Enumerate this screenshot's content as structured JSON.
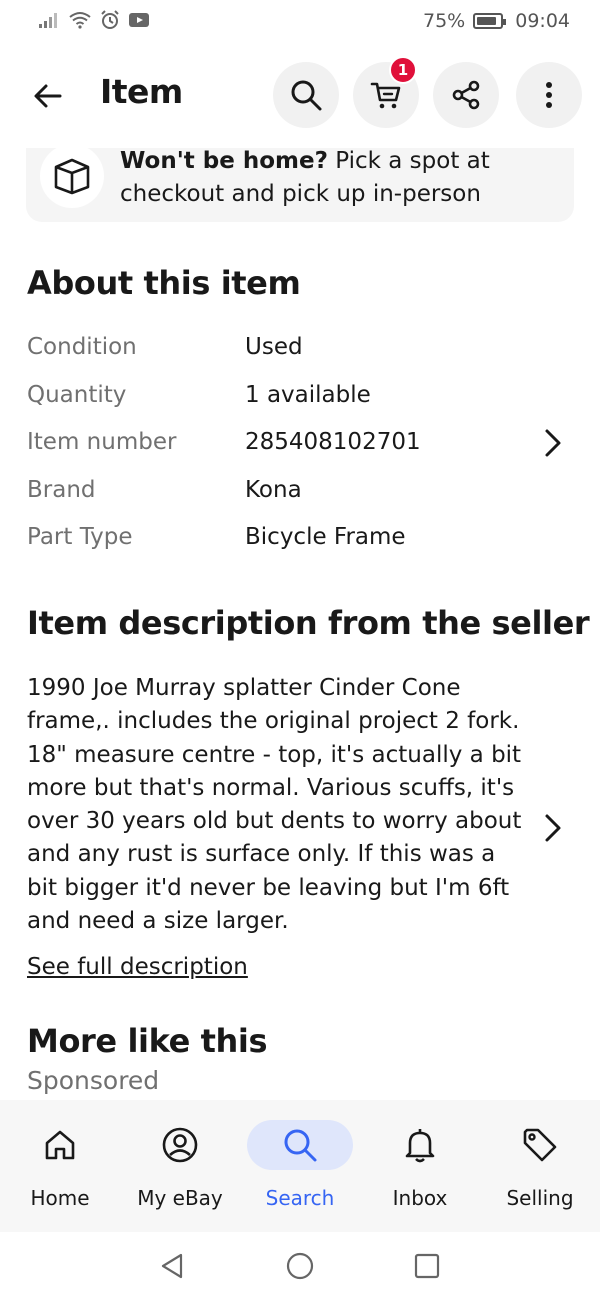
{
  "status_bar": {
    "battery_text": "75%",
    "time": "09:04",
    "icons": [
      "signal-icon",
      "wifi-icon",
      "alarm-icon",
      "youtube-icon"
    ]
  },
  "header": {
    "title": "Item",
    "cart_count": "1",
    "icons": [
      "back-arrow-icon",
      "search-icon",
      "cart-icon",
      "share-icon",
      "more-vertical-icon"
    ]
  },
  "pickup_banner": {
    "bold": "Won't be home?",
    "text": " Pick a spot at checkout and pick up in-person",
    "icon": "box-icon"
  },
  "about": {
    "title": "About this item",
    "specs": [
      {
        "label": "Condition",
        "value": "Used"
      },
      {
        "label": "Quantity",
        "value": "1 available"
      },
      {
        "label": "Item number",
        "value": "285408102701"
      },
      {
        "label": "Brand",
        "value": "Kona"
      },
      {
        "label": "Part Type",
        "value": "Bicycle Frame"
      }
    ]
  },
  "description": {
    "title": "Item description from the seller",
    "text": "1990 Joe Murray splatter Cinder Cone frame,. includes the original project 2 fork. 18\" measure centre - top, it's actually a bit more but that's normal. Various scuffs, it's over 30 years old but dents to worry about and any rust is surface only. If this was a bit bigger it'd never be leaving but I'm 6ft and need a size larger.",
    "link": "See full description"
  },
  "more_like_this": {
    "title": "More like this",
    "subtitle": "Sponsored"
  },
  "bottom_nav": {
    "items": [
      {
        "label": "Home",
        "icon": "home-icon"
      },
      {
        "label": "My eBay",
        "icon": "account-icon"
      },
      {
        "label": "Search",
        "icon": "search-icon",
        "active": true
      },
      {
        "label": "Inbox",
        "icon": "bell-icon"
      },
      {
        "label": "Selling",
        "icon": "tag-icon"
      }
    ]
  },
  "colors": {
    "accent": "#3665f3",
    "badge": "#e0103a",
    "text": "#191919",
    "muted": "#707070"
  }
}
